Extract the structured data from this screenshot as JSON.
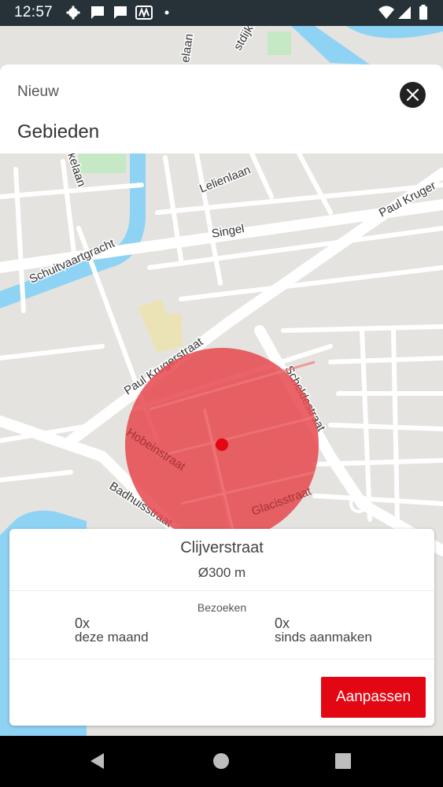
{
  "status_bar": {
    "time": "12:57",
    "icons": [
      "gear-icon",
      "message-icon",
      "message-icon",
      "nu-app-icon",
      "dot-icon",
      "wifi-icon",
      "signal-icon",
      "battery-icon"
    ]
  },
  "header": {
    "subtitle": "Nieuw",
    "title": "Gebieden",
    "close_icon": "close-icon"
  },
  "map": {
    "streets": [
      "Paul Krugerstraat",
      "Paul Kruger",
      "Singel",
      "Lelienlaan",
      "Schuitvaartgracht",
      "kelaan",
      "stdijk",
      "elaan",
      "Scheldestraat",
      "Hobeinstraat",
      "Badhuisstraat",
      "Glacisstraat"
    ],
    "area_color": "#e5484d"
  },
  "card": {
    "area_name": "Clijverstraat",
    "diameter": "Ø300 m",
    "visits_label": "Bezoeken",
    "stats": [
      {
        "count": "0x",
        "label": "deze maand"
      },
      {
        "count": "0x",
        "label": "sinds aanmaken"
      }
    ],
    "edit_button": "Aanpassen"
  },
  "nav": {
    "back_icon": "back-icon",
    "home_icon": "home-icon",
    "recents_icon": "recents-icon"
  },
  "colors": {
    "accent": "#e30613",
    "status_bar": "#263238",
    "map_background": "#e5e3df",
    "water": "#8fd3f4"
  }
}
